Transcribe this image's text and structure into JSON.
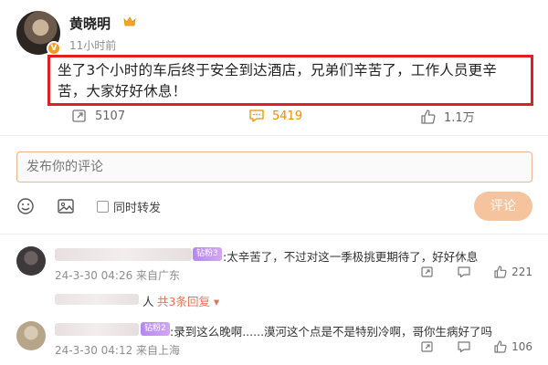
{
  "post": {
    "username": "黄晓明",
    "time": "11小时前",
    "text": "坐了3个小时的车后终于安全到达酒店，兄弟们辛苦了，工作人员更辛苦，大家好好休息！",
    "badge_icon": "v-verified-icon"
  },
  "actions": {
    "repost_count": "5107",
    "comment_count": "5419",
    "like_count": "1.1万"
  },
  "composer": {
    "placeholder": "发布你的评论",
    "repost_label": "同时转发",
    "submit_label": "评论"
  },
  "comments": [
    {
      "badge": "钻粉3",
      "text": ":太辛苦了，不过对这一季极挑更期待了，好好休息",
      "meta": "24-3-30 04:26 来自广东",
      "likes": "221"
    },
    {
      "badge": "钻粉2",
      "text": ":录到这么晚啊......漠河这个点是不是特别冷啊，哥你生病好了吗",
      "meta": "24-3-30 04:12 来自上海",
      "likes": "106"
    }
  ],
  "reply": {
    "suffix": "人",
    "count_label": "共3条回复 ▾"
  },
  "colors": {
    "highlight_border": "#e02020",
    "accent_orange": "#f28c00",
    "submit_button": "#f5c39e",
    "reply_link": "#eb7350"
  }
}
